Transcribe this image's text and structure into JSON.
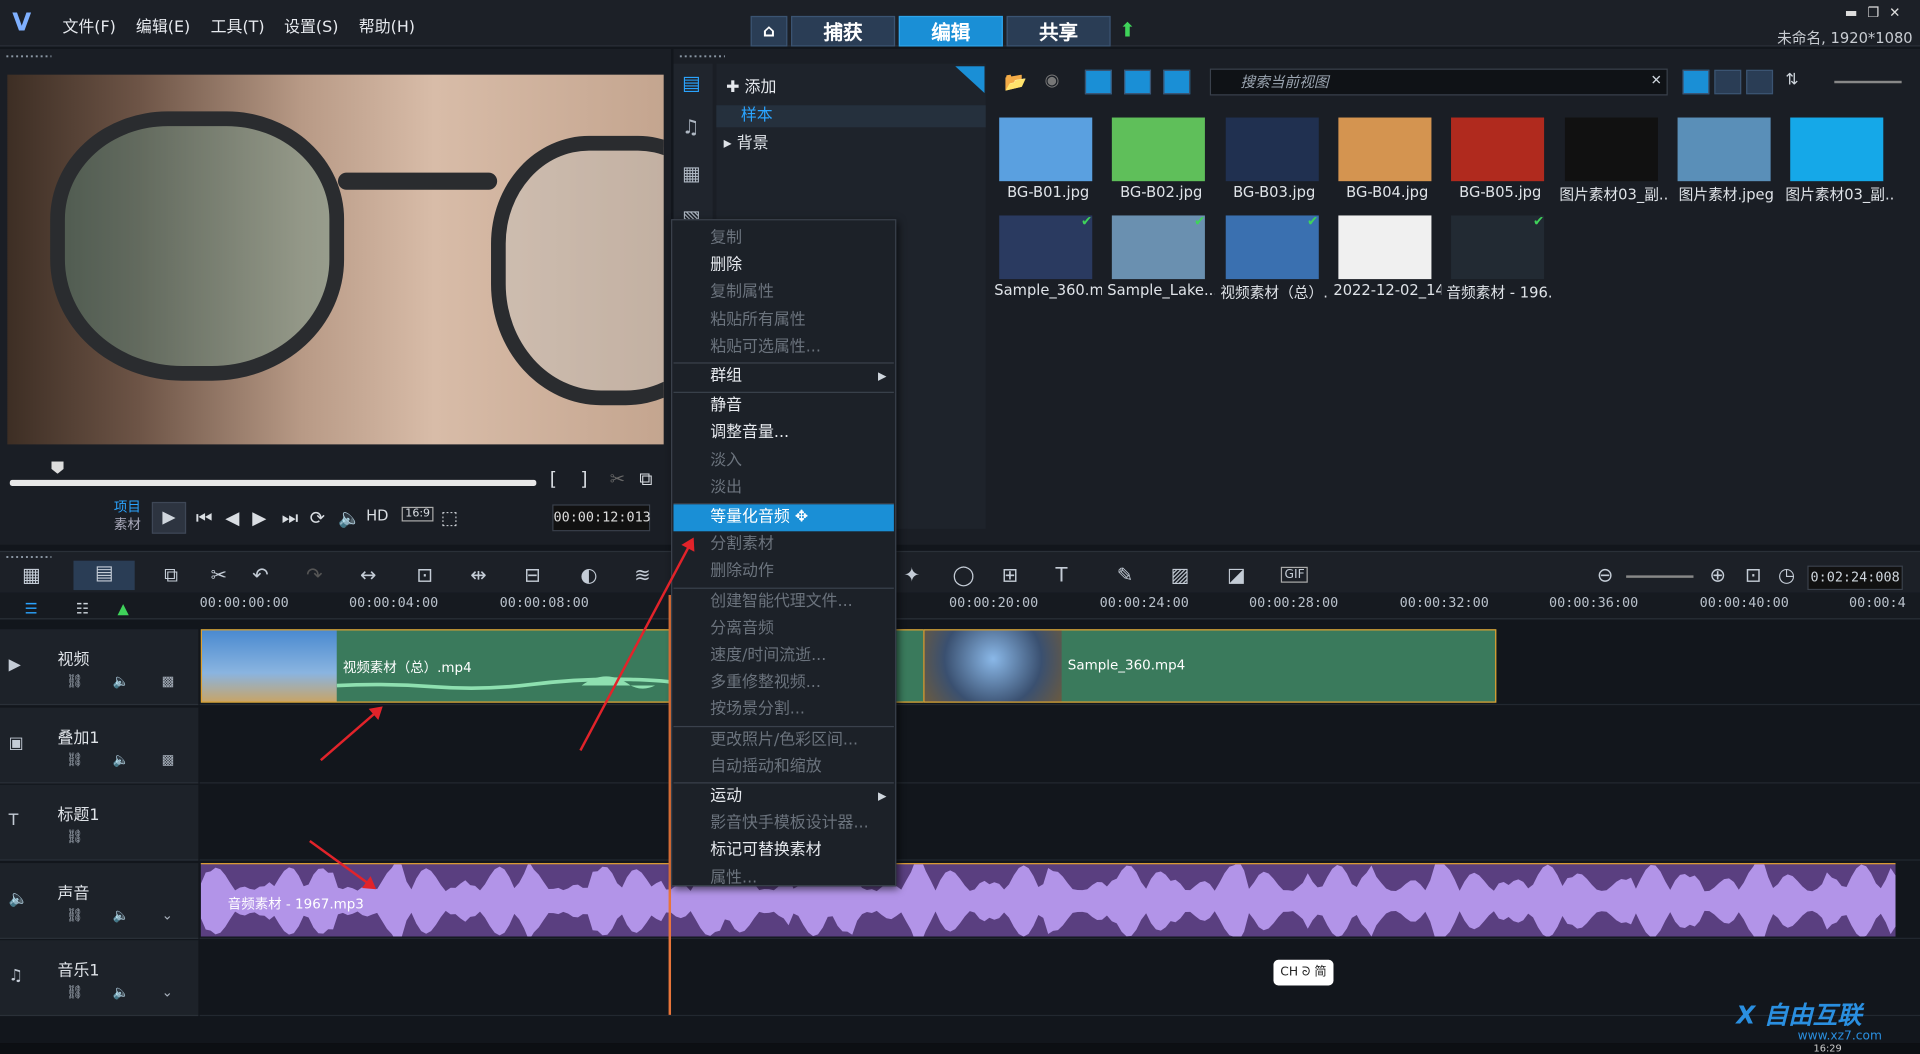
{
  "menu": [
    "文件(F)",
    "编辑(E)",
    "工具(T)",
    "设置(S)",
    "帮助(H)"
  ],
  "nav": {
    "capture": "捕获",
    "edit": "编辑",
    "share": "共享"
  },
  "window": {
    "title": "未命名, 1920*1080"
  },
  "player": {
    "mode_project": "项目",
    "mode_clip": "素材",
    "hd": "HD",
    "ratio": "16:9",
    "timecode": "00:00:12:013"
  },
  "library": {
    "add": "添加",
    "folder_sample": "样本",
    "folder_bg": "背景",
    "search_placeholder": "搜索当前视图",
    "thumbs": [
      {
        "name": "BG-B01.jpg",
        "color": "#5aa0e0"
      },
      {
        "name": "BG-B02.jpg",
        "color": "#5fbf5a"
      },
      {
        "name": "BG-B03.jpg",
        "color": "#203050"
      },
      {
        "name": "BG-B04.jpg",
        "color": "#d49450"
      },
      {
        "name": "BG-B05.jpg",
        "color": "#b02a1e"
      },
      {
        "name": "图片素材03_副...",
        "color": "#111111"
      },
      {
        "name": "图片素材.jpeg",
        "color": "#5a8fb8"
      },
      {
        "name": "图片素材03_副...",
        "color": "#15a8e8"
      },
      {
        "name": "Sample_360.m...",
        "color": "#2a3a60"
      },
      {
        "name": "Sample_Lake....",
        "color": "#6a90b0"
      },
      {
        "name": "视频素材（总）....",
        "color": "#3a70b0"
      },
      {
        "name": "2022-12-02_14...",
        "color": "#f0f0f0"
      },
      {
        "name": "音频素材 - 196...",
        "color": "#222a33"
      }
    ]
  },
  "timeline": {
    "total": "0:02:24:008",
    "ticks": [
      "00:00:00:00",
      "00:00:04:00",
      "00:00:08:00",
      "00:00:20:00",
      "00:00:24:00",
      "00:00:28:00",
      "00:00:32:00",
      "00:00:36:00",
      "00:00:40:00",
      "00:00:4"
    ],
    "tracks": [
      "视频",
      "叠加1",
      "标题1",
      "声音",
      "音乐1"
    ],
    "clip1": "视频素材（总）.mp4",
    "clip2": "Sample_360.mp4",
    "audio": "音频素材 - 1967.mp3"
  },
  "context_menu": {
    "items": [
      {
        "label": "复制",
        "state": "disabled"
      },
      {
        "label": "删除",
        "state": "enabled"
      },
      {
        "label": "复制属性",
        "state": "disabled"
      },
      {
        "label": "粘贴所有属性",
        "state": "disabled"
      },
      {
        "label": "粘贴可选属性...",
        "state": "disabled"
      },
      {
        "label": "群组",
        "state": "enabled",
        "submenu": true
      },
      {
        "label": "静音",
        "state": "enabled"
      },
      {
        "label": "调整音量...",
        "state": "enabled"
      },
      {
        "label": "淡入",
        "state": "disabled"
      },
      {
        "label": "淡出",
        "state": "disabled"
      },
      {
        "label": "等量化音频",
        "state": "highlighted"
      },
      {
        "label": "分割素材",
        "state": "disabled"
      },
      {
        "label": "删除动作",
        "state": "disabled"
      },
      {
        "label": "创建智能代理文件...",
        "state": "disabled"
      },
      {
        "label": "分离音频",
        "state": "disabled"
      },
      {
        "label": "速度/时间流逝...",
        "state": "disabled"
      },
      {
        "label": "多重修整视频...",
        "state": "disabled"
      },
      {
        "label": "按场景分割...",
        "state": "disabled"
      },
      {
        "label": "更改照片/色彩区间...",
        "state": "disabled"
      },
      {
        "label": "自动摇动和缩放",
        "state": "disabled"
      },
      {
        "label": "运动",
        "state": "enabled",
        "submenu": true
      },
      {
        "label": "影音快手模板设计器...",
        "state": "disabled"
      },
      {
        "label": "标记可替换素材",
        "state": "enabled"
      },
      {
        "label": "属性...",
        "state": "disabled"
      }
    ]
  },
  "ime": "CH ᘐ 简",
  "watermark": {
    "brand": "X 自由互联",
    "url": "www.xz7.com"
  },
  "taskbar_time": "16:29",
  "colors": {
    "accent": "#1a8fd6",
    "annotation": "#e2232a",
    "video_clip": "#3a7a5c",
    "audio_clip": "#5a3f80"
  }
}
